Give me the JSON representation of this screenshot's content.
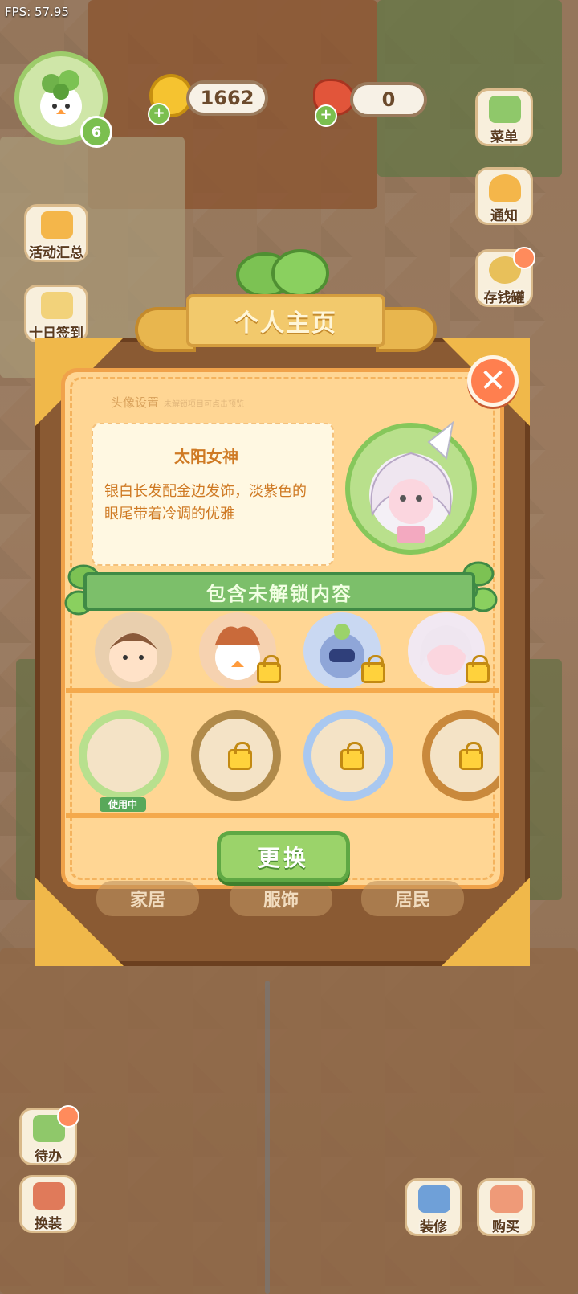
{
  "fps": "FPS: 57.95",
  "hud": {
    "level": "6",
    "coins": "1662",
    "carrots": "0",
    "plus": "+"
  },
  "side_left": [
    {
      "label": "活动汇总",
      "icon": "crown-icon"
    },
    {
      "label": "十日签到",
      "icon": "calendar-icon"
    },
    {
      "label": "待办",
      "icon": "clipboard-icon"
    },
    {
      "label": "换装",
      "icon": "wardrobe-icon"
    }
  ],
  "side_right": [
    {
      "label": "菜单",
      "icon": "menu-icon"
    },
    {
      "label": "通知",
      "icon": "bell-icon"
    },
    {
      "label": "存钱罐",
      "icon": "piggy-bank-icon"
    },
    {
      "label": "装修",
      "icon": "renovate-icon"
    },
    {
      "label": "购买",
      "icon": "shopping-bag-icon"
    }
  ],
  "dialog": {
    "title": "个人主页",
    "section_title": "头像设置",
    "section_hint": "未解锁项目可点击预览",
    "avatar_name": "太阳女神",
    "avatar_desc": "银白长发配金边发饰，淡紫色的眼尾带着冷调的优雅",
    "unlock_banner": "包含未解锁内容",
    "in_use_label": "使用中",
    "change_button": "更换",
    "close": "✕"
  },
  "background_tabs": [
    "家居",
    "服饰",
    "居民"
  ],
  "colors": {
    "panel": "#ffd694",
    "panel_border": "#f0a24a",
    "accent_green": "#9bd36a",
    "text_orange": "#cf7a24",
    "close_red": "#ff7f4f"
  }
}
